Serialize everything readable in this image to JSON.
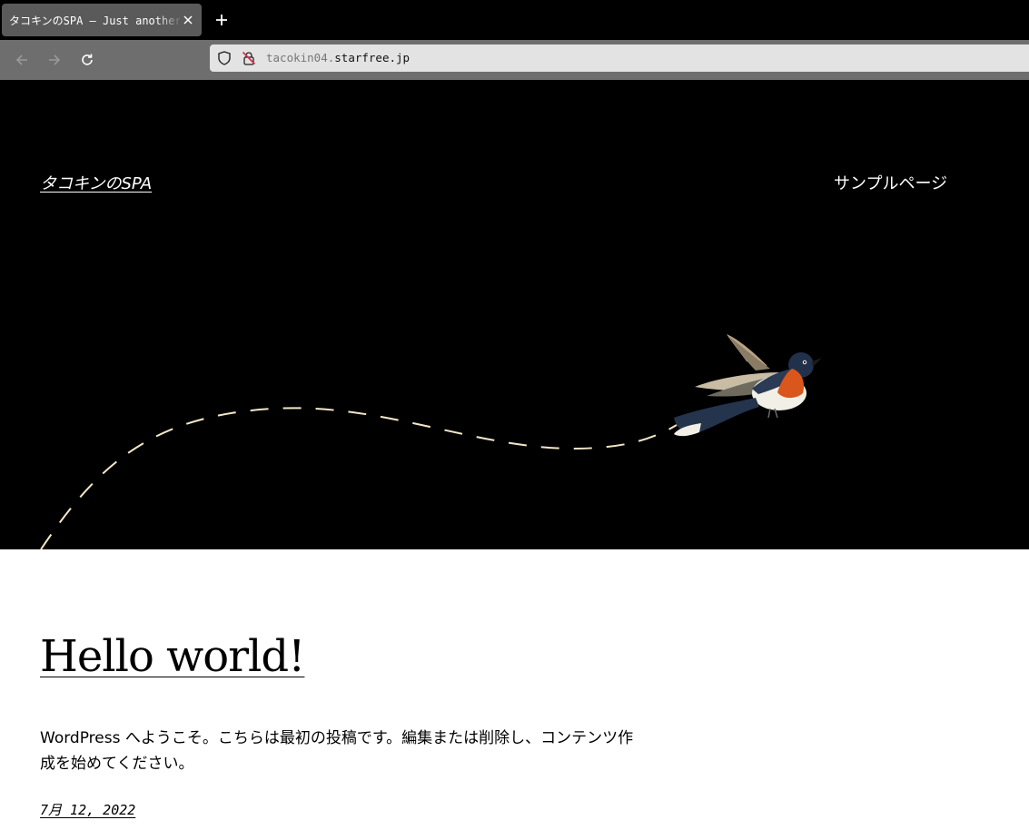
{
  "browser": {
    "tab_title": "タコキンのSPA – Just another WordPress site",
    "url_subdomain": "tacokin04.",
    "url_domain": "starfree.jp",
    "icons": {
      "tab_close": "close-icon",
      "new_tab": "plus-icon",
      "back": "arrow-left-icon",
      "forward": "arrow-right-icon",
      "reload": "reload-icon",
      "tracking": "shield-icon",
      "security": "insecure-lock-icon"
    }
  },
  "site": {
    "title": "タコキンのSPA",
    "nav": [
      "サンプルページ"
    ],
    "header_image": "bird-with-dashed-flight-path"
  },
  "post": {
    "title": "Hello world!",
    "excerpt": "WordPress へようこそ。こちらは最初の投稿です。編集または削除し、コンテンツ作成を始めてください。",
    "date": "7月 12, 2022"
  },
  "colors": {
    "header_bg": "#000000",
    "page_bg": "#ffffff",
    "path_dash": "#f3e7c8"
  }
}
